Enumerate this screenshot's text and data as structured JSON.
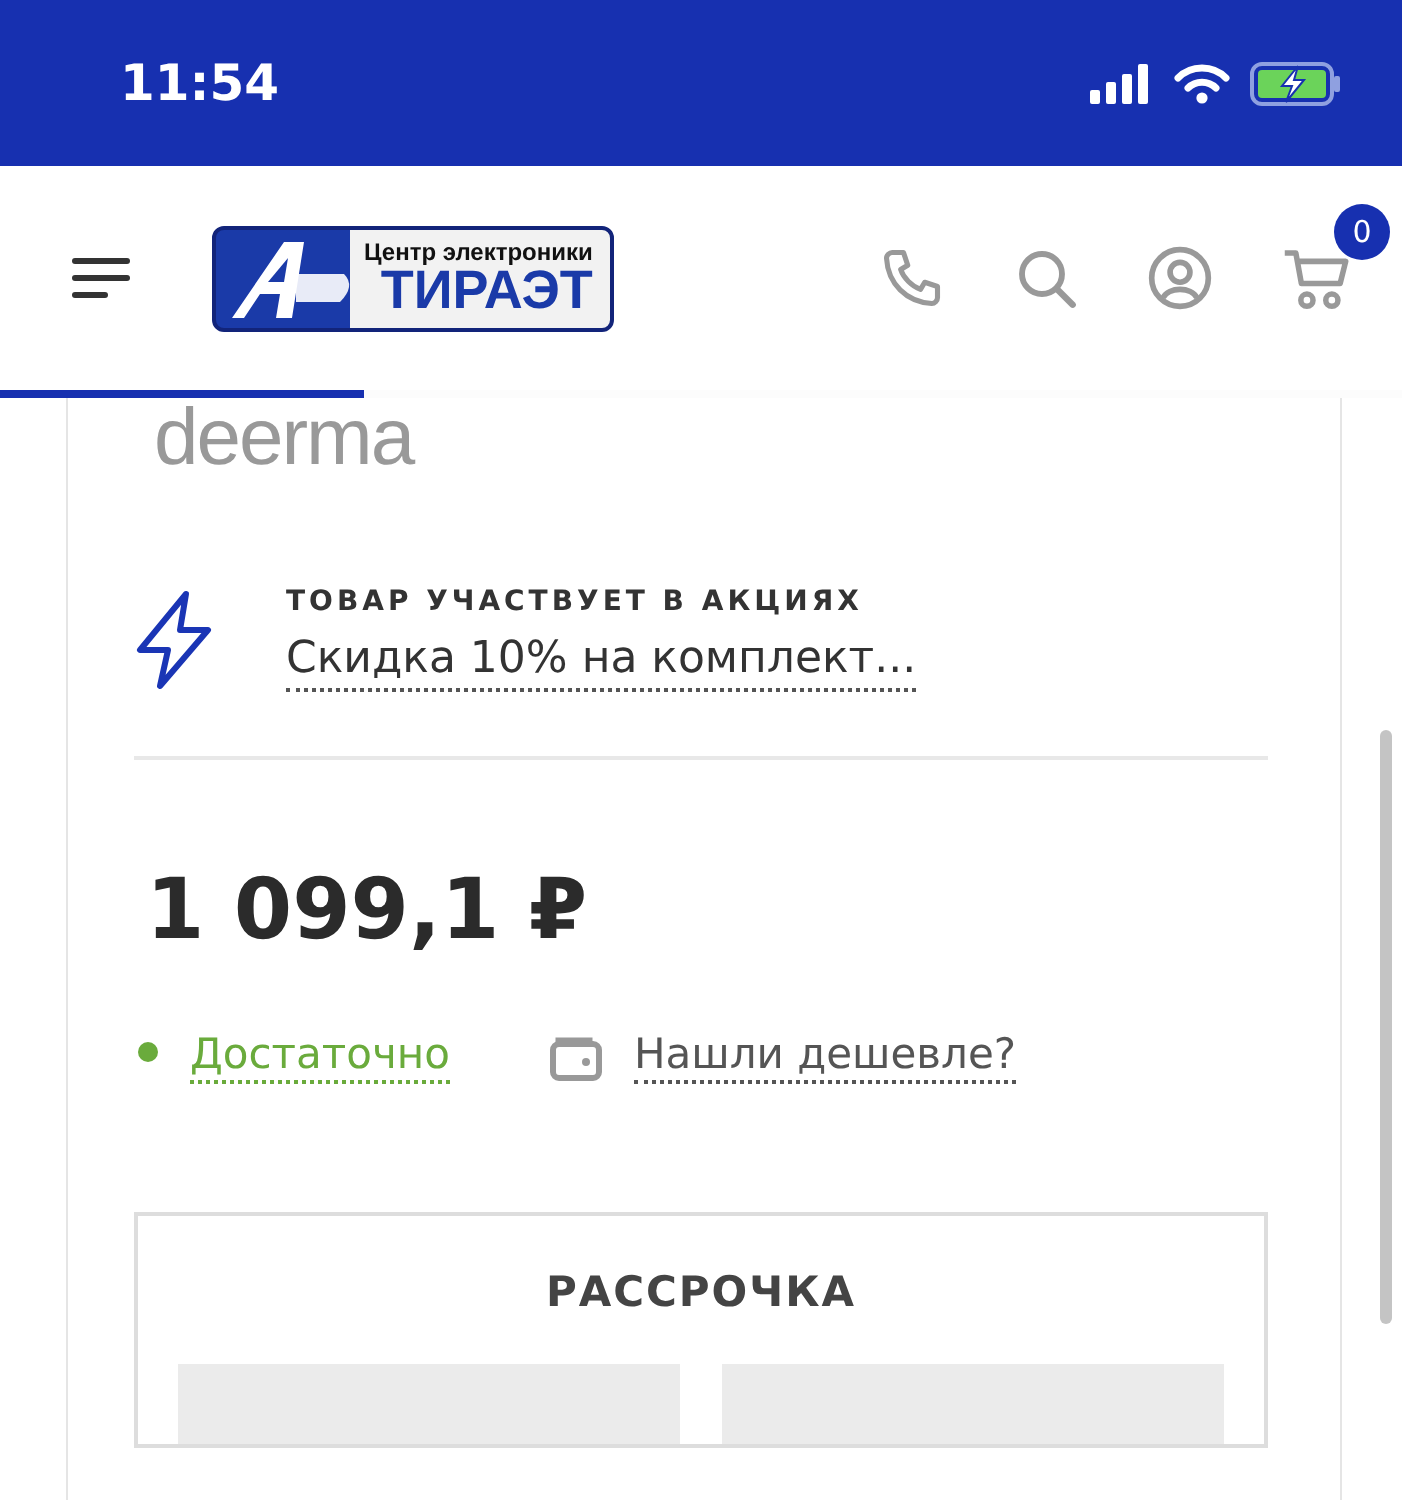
{
  "status_bar": {
    "time": "11:54"
  },
  "header": {
    "logo": {
      "tagline": "Центр электроники",
      "name": "ТИРАЭТ"
    },
    "cart_count": "0"
  },
  "loading_bar": {
    "level": 0.26
  },
  "product": {
    "brand_logo": "deerma",
    "promo": {
      "heading": "ТОВАР УЧАСТВУЕТ В АКЦИЯХ",
      "link": "Скидка 10% на комплект..."
    },
    "price": "1 099,1 ₽",
    "stock": {
      "label": "Достаточно",
      "color": "#6aab3c"
    },
    "cheaper_link": "Нашли дешевле?",
    "installment": {
      "title": "РАССРОЧКА",
      "options": [
        {
          "kind": "placeholder"
        },
        {
          "kind": "placeholder"
        }
      ]
    }
  }
}
